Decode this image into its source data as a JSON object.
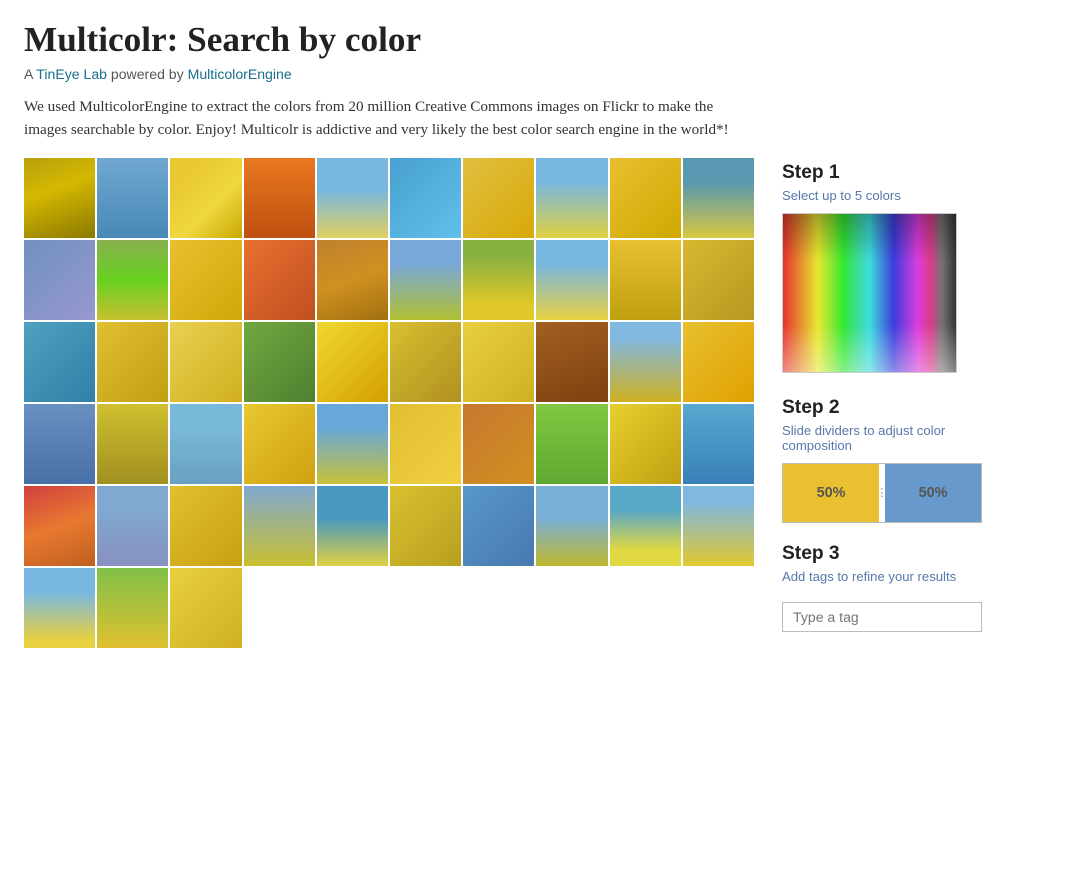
{
  "page": {
    "title": "Multicolr: Search by color",
    "subtitle_text": "A TinEye Lab powered by MulticolorEngine",
    "tineye_label": "TinEye Lab",
    "engine_label": "MulticolorEngine",
    "description": "We used MulticolorEngine to extract the colors from 20 million Creative Commons images on Flickr to make the images searchable by color. Enjoy! Multicolr is addictive and very likely the best color search engine in the world*!"
  },
  "sidebar": {
    "step1": {
      "title": "Step 1",
      "desc": "Select up to 5 colors"
    },
    "step2": {
      "title": "Step 2",
      "desc": "Slide dividers to adjust color composition",
      "bar1_pct": "50%",
      "bar2_pct": "50%"
    },
    "step3": {
      "title": "Step 3",
      "desc": "Add tags to refine your results",
      "tag_placeholder": "Type a tag"
    }
  }
}
